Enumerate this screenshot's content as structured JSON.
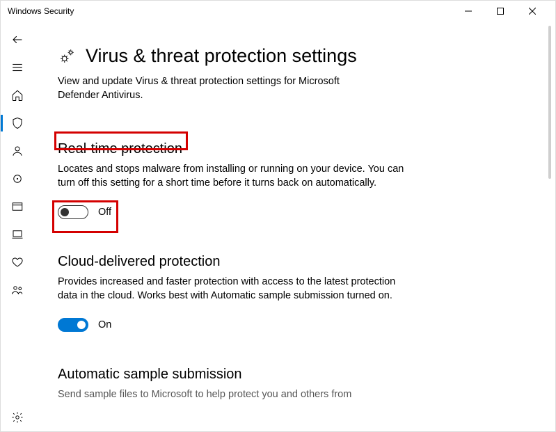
{
  "window": {
    "title": "Windows Security"
  },
  "page": {
    "title": "Virus & threat protection settings",
    "subtitle": "View and update Virus & threat protection settings for Microsoft Defender Antivirus."
  },
  "sections": {
    "realtime": {
      "title": "Real-time protection",
      "desc": "Locates and stops malware from installing or running on your device. You can turn off this setting for a short time before it turns back on automatically.",
      "toggle_state": "Off"
    },
    "cloud": {
      "title": "Cloud-delivered protection",
      "desc": "Provides increased and faster protection with access to the latest protection data in the cloud. Works best with Automatic sample submission turned on.",
      "toggle_state": "On"
    },
    "sample": {
      "title": "Automatic sample submission",
      "desc": "Send sample files to Microsoft to help protect you and others from"
    }
  }
}
